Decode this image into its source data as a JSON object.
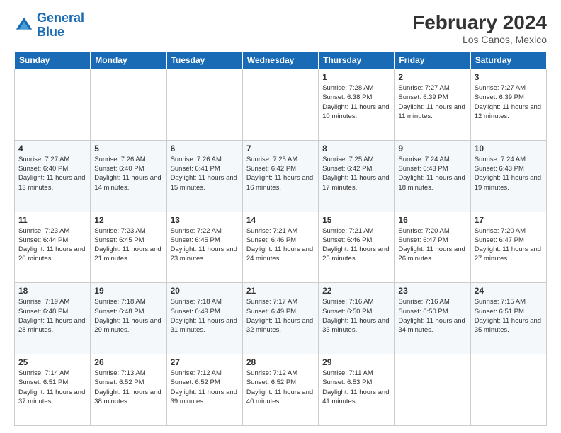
{
  "logo": {
    "line1": "General",
    "line2": "Blue"
  },
  "title": "February 2024",
  "subtitle": "Los Canos, Mexico",
  "weekdays": [
    "Sunday",
    "Monday",
    "Tuesday",
    "Wednesday",
    "Thursday",
    "Friday",
    "Saturday"
  ],
  "weeks": [
    [
      {
        "day": "",
        "info": ""
      },
      {
        "day": "",
        "info": ""
      },
      {
        "day": "",
        "info": ""
      },
      {
        "day": "",
        "info": ""
      },
      {
        "day": "1",
        "info": "Sunrise: 7:28 AM\nSunset: 6:38 PM\nDaylight: 11 hours and 10 minutes."
      },
      {
        "day": "2",
        "info": "Sunrise: 7:27 AM\nSunset: 6:39 PM\nDaylight: 11 hours and 11 minutes."
      },
      {
        "day": "3",
        "info": "Sunrise: 7:27 AM\nSunset: 6:39 PM\nDaylight: 11 hours and 12 minutes."
      }
    ],
    [
      {
        "day": "4",
        "info": "Sunrise: 7:27 AM\nSunset: 6:40 PM\nDaylight: 11 hours and 13 minutes."
      },
      {
        "day": "5",
        "info": "Sunrise: 7:26 AM\nSunset: 6:40 PM\nDaylight: 11 hours and 14 minutes."
      },
      {
        "day": "6",
        "info": "Sunrise: 7:26 AM\nSunset: 6:41 PM\nDaylight: 11 hours and 15 minutes."
      },
      {
        "day": "7",
        "info": "Sunrise: 7:25 AM\nSunset: 6:42 PM\nDaylight: 11 hours and 16 minutes."
      },
      {
        "day": "8",
        "info": "Sunrise: 7:25 AM\nSunset: 6:42 PM\nDaylight: 11 hours and 17 minutes."
      },
      {
        "day": "9",
        "info": "Sunrise: 7:24 AM\nSunset: 6:43 PM\nDaylight: 11 hours and 18 minutes."
      },
      {
        "day": "10",
        "info": "Sunrise: 7:24 AM\nSunset: 6:43 PM\nDaylight: 11 hours and 19 minutes."
      }
    ],
    [
      {
        "day": "11",
        "info": "Sunrise: 7:23 AM\nSunset: 6:44 PM\nDaylight: 11 hours and 20 minutes."
      },
      {
        "day": "12",
        "info": "Sunrise: 7:23 AM\nSunset: 6:45 PM\nDaylight: 11 hours and 21 minutes."
      },
      {
        "day": "13",
        "info": "Sunrise: 7:22 AM\nSunset: 6:45 PM\nDaylight: 11 hours and 23 minutes."
      },
      {
        "day": "14",
        "info": "Sunrise: 7:21 AM\nSunset: 6:46 PM\nDaylight: 11 hours and 24 minutes."
      },
      {
        "day": "15",
        "info": "Sunrise: 7:21 AM\nSunset: 6:46 PM\nDaylight: 11 hours and 25 minutes."
      },
      {
        "day": "16",
        "info": "Sunrise: 7:20 AM\nSunset: 6:47 PM\nDaylight: 11 hours and 26 minutes."
      },
      {
        "day": "17",
        "info": "Sunrise: 7:20 AM\nSunset: 6:47 PM\nDaylight: 11 hours and 27 minutes."
      }
    ],
    [
      {
        "day": "18",
        "info": "Sunrise: 7:19 AM\nSunset: 6:48 PM\nDaylight: 11 hours and 28 minutes."
      },
      {
        "day": "19",
        "info": "Sunrise: 7:18 AM\nSunset: 6:48 PM\nDaylight: 11 hours and 29 minutes."
      },
      {
        "day": "20",
        "info": "Sunrise: 7:18 AM\nSunset: 6:49 PM\nDaylight: 11 hours and 31 minutes."
      },
      {
        "day": "21",
        "info": "Sunrise: 7:17 AM\nSunset: 6:49 PM\nDaylight: 11 hours and 32 minutes."
      },
      {
        "day": "22",
        "info": "Sunrise: 7:16 AM\nSunset: 6:50 PM\nDaylight: 11 hours and 33 minutes."
      },
      {
        "day": "23",
        "info": "Sunrise: 7:16 AM\nSunset: 6:50 PM\nDaylight: 11 hours and 34 minutes."
      },
      {
        "day": "24",
        "info": "Sunrise: 7:15 AM\nSunset: 6:51 PM\nDaylight: 11 hours and 35 minutes."
      }
    ],
    [
      {
        "day": "25",
        "info": "Sunrise: 7:14 AM\nSunset: 6:51 PM\nDaylight: 11 hours and 37 minutes."
      },
      {
        "day": "26",
        "info": "Sunrise: 7:13 AM\nSunset: 6:52 PM\nDaylight: 11 hours and 38 minutes."
      },
      {
        "day": "27",
        "info": "Sunrise: 7:12 AM\nSunset: 6:52 PM\nDaylight: 11 hours and 39 minutes."
      },
      {
        "day": "28",
        "info": "Sunrise: 7:12 AM\nSunset: 6:52 PM\nDaylight: 11 hours and 40 minutes."
      },
      {
        "day": "29",
        "info": "Sunrise: 7:11 AM\nSunset: 6:53 PM\nDaylight: 11 hours and 41 minutes."
      },
      {
        "day": "",
        "info": ""
      },
      {
        "day": "",
        "info": ""
      }
    ]
  ]
}
